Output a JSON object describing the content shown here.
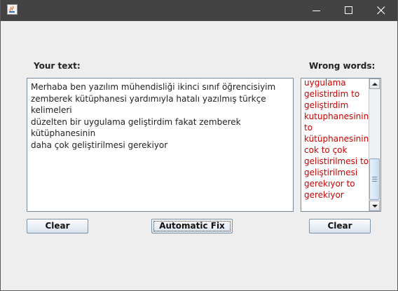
{
  "window": {
    "title": "",
    "controls": {
      "minimize_icon": "minimize-icon",
      "maximize_icon": "maximize-icon",
      "close_icon": "close-icon"
    }
  },
  "labels": {
    "your_text": "Your text:",
    "wrong_words": "Wrong words:"
  },
  "text_area": {
    "value": "Merhaba ben yazılım mühendisliği ikinci sınıf öğrencisiyim\nzemberek kütüphanesi yardımıyla hatalı yazılmış türkçe kelimeleri\ndüzelten bir uygulama geliştirdim fakat zemberek kütüphanesinin\ndaha çok geliştirilmesi gerekiyor"
  },
  "wrong_words": {
    "items": [
      "uygulama",
      "gelistirdim to",
      "geliştirdim",
      "kutuphanesinin",
      "to",
      "kütüphanesinin",
      "cok to çok",
      "gelistirilmesi to",
      "geliştirilmesi",
      "gerekıyor to",
      "gerekiyor"
    ]
  },
  "buttons": {
    "clear_left": "Clear",
    "automatic_fix": "Automatic Fix",
    "clear_right": "Clear"
  },
  "colors": {
    "titlebar": "#434343",
    "wrong_word_text": "#cc0000",
    "window_bg": "#eeeeee"
  }
}
